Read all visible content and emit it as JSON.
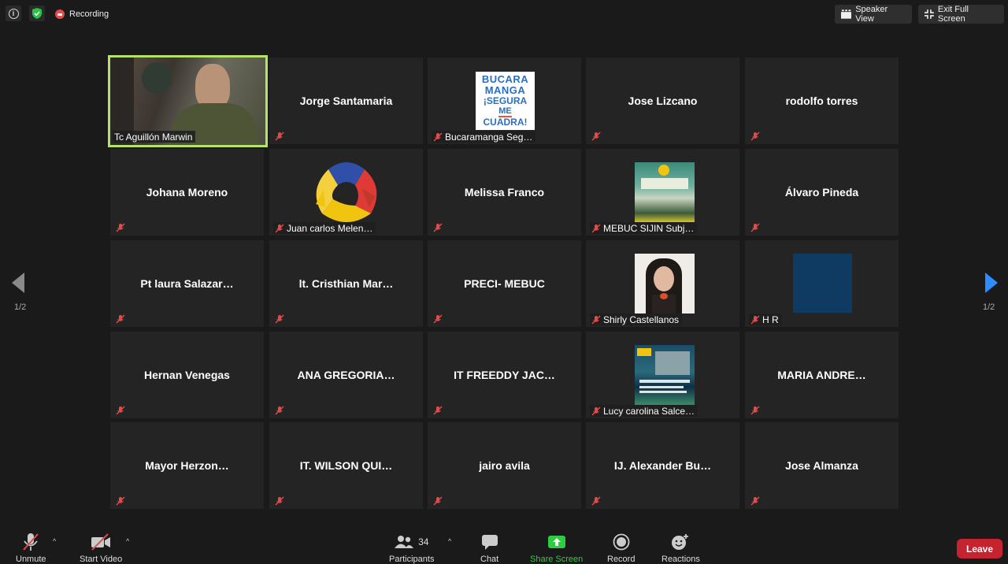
{
  "top": {
    "recording_label": "Recording",
    "speaker_view_label": "Speaker View",
    "exit_fullscreen_label": "Exit Full Screen"
  },
  "tiles": [
    {
      "name": "",
      "label": "Tc Aguillón Marwin",
      "video": true
    },
    {
      "name": "Jorge Santamaria",
      "label": ""
    },
    {
      "name": "",
      "label": "Bucaramanga Seg…",
      "thumb": "bucaramanga-logo",
      "thumb_text": [
        "BUCARA",
        "MANGA",
        "¡SEGURA",
        "ME",
        "CUADRA!"
      ]
    },
    {
      "name": "Jose Lizcano",
      "label": ""
    },
    {
      "name": "rodolfo torres",
      "label": ""
    },
    {
      "name": "Johana Moreno",
      "label": ""
    },
    {
      "name": "",
      "label": "Juan carlos Melen…",
      "thumb": "hands-logo"
    },
    {
      "name": "Melissa Franco",
      "label": ""
    },
    {
      "name": "",
      "label": "MEBUC SIJIN Subj…",
      "thumb": "police-poster"
    },
    {
      "name": "Álvaro Pineda",
      "label": ""
    },
    {
      "name": "Pt  laura  Salazar…",
      "label": ""
    },
    {
      "name": "lt.  Cristhian  Mar…",
      "label": ""
    },
    {
      "name": "PRECI- MEBUC",
      "label": ""
    },
    {
      "name": "",
      "label": "Shirly Castellanos",
      "thumb": "profile-photo"
    },
    {
      "name": "",
      "label": "H R",
      "thumb": "blue-square"
    },
    {
      "name": "Hernan Venegas",
      "label": ""
    },
    {
      "name": "ANA GREGORIA…",
      "label": ""
    },
    {
      "name": "IT FREEDDY JAC…",
      "label": ""
    },
    {
      "name": "",
      "label": "Lucy carolina Salce…",
      "thumb": "campaign-poster"
    },
    {
      "name": "MARIA ANDRE…",
      "label": ""
    },
    {
      "name": "Mayor  Herzon…",
      "label": ""
    },
    {
      "name": "IT. WILSON QUI…",
      "label": ""
    },
    {
      "name": "jairo avila",
      "label": ""
    },
    {
      "name": "IJ. Alexander Bu…",
      "label": ""
    },
    {
      "name": "Jose Almanza",
      "label": ""
    }
  ],
  "pagination": {
    "left": "1/2",
    "right": "1/2"
  },
  "toolbar": {
    "unmute": "Unmute",
    "start_video": "Start Video",
    "participants": "Participants",
    "participants_count": "34",
    "chat": "Chat",
    "share_screen": "Share Screen",
    "record": "Record",
    "reactions": "Reactions",
    "leave": "Leave"
  },
  "colors": {
    "active_speaker_border": "#b5e36a",
    "share_green": "#2ecc40",
    "leave_red": "#c4232f",
    "mute_red": "#e14b4b",
    "nav_blue": "#2d8cff"
  }
}
